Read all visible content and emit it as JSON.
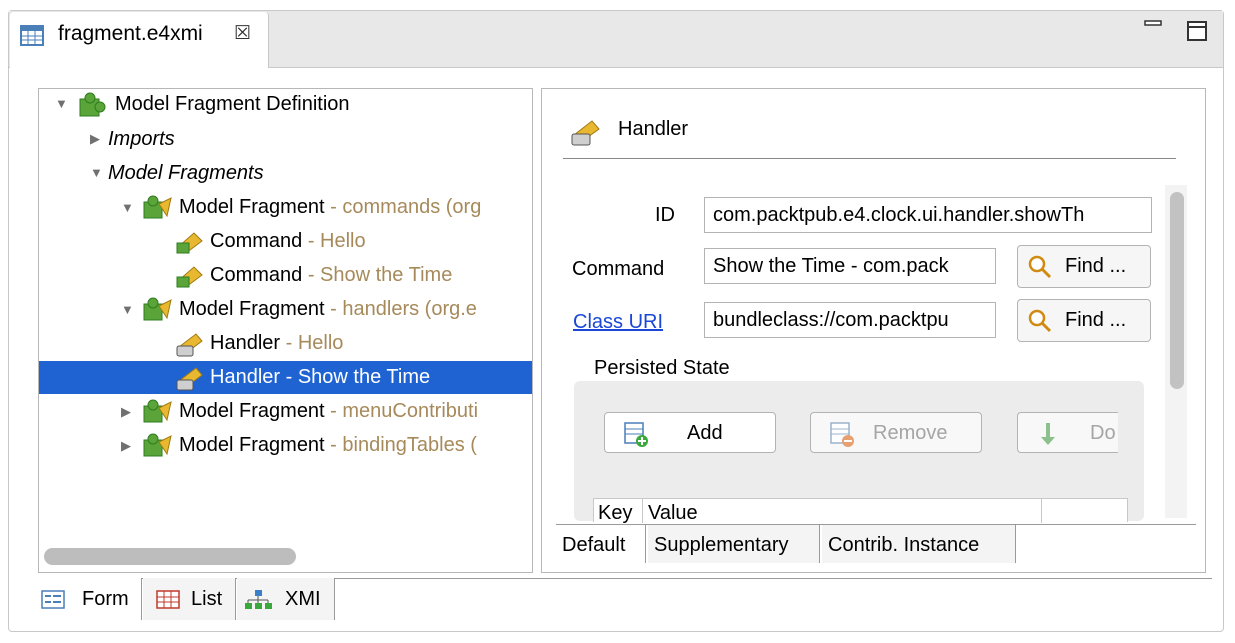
{
  "editor": {
    "tab_title": "fragment.e4xmi",
    "close_glyph": "☒",
    "minimize_icon": "minimize-icon",
    "maximize_icon": "maximize-icon"
  },
  "tree": {
    "root": "Model Fragment Definition",
    "imports": "Imports",
    "model_fragments": "Model Fragments",
    "frag_commands": {
      "label": "Model Fragment",
      "detail": " - commands (org"
    },
    "cmd_hello": {
      "label": "Command",
      "detail": " - Hello"
    },
    "cmd_show": {
      "label": "Command",
      "detail": " - Show the Time"
    },
    "frag_handlers": {
      "label": "Model Fragment",
      "detail": " - handlers (org.e"
    },
    "hnd_hello": {
      "label": "Handler",
      "detail": " - Hello"
    },
    "hnd_show": {
      "label": "Handler",
      "detail": " - Show the Time"
    },
    "frag_menu": {
      "label": "Model Fragment",
      "detail": " - menuContributi"
    },
    "frag_binding": {
      "label": "Model Fragment",
      "detail": " - bindingTables ("
    }
  },
  "detail": {
    "header": "Handler",
    "id_label": "ID",
    "id_value": "com.packtpub.e4.clock.ui.handler.showTh",
    "command_label": "Command",
    "command_value": "Show the Time - com.pack",
    "find_label": "Find ...",
    "class_label": "Class URI",
    "class_value": "bundleclass://com.packtpu",
    "persisted_state": "Persisted State",
    "add": "Add",
    "remove": "Remove",
    "down": "Do",
    "col_key": "Key",
    "col_value": "Value",
    "tabs": [
      "Default",
      "Supplementary",
      "Contrib. Instance"
    ]
  },
  "bottom_tabs": [
    "Form",
    "List",
    "XMI"
  ]
}
